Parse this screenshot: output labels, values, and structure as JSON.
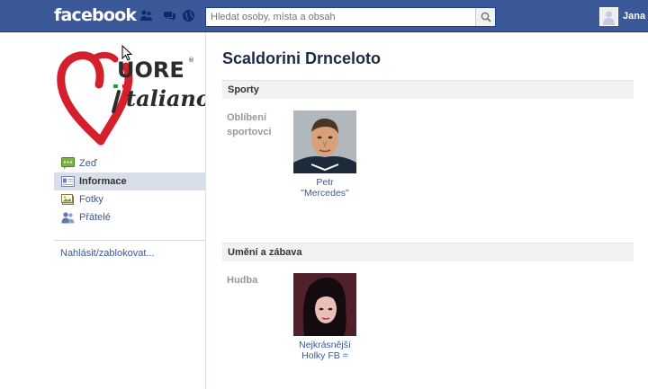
{
  "header": {
    "logo": "facebook",
    "search_placeholder": "Hledat osoby, místa a obsah",
    "user_name": "Jana"
  },
  "sidebar": {
    "items": [
      {
        "label": "Zeď",
        "active": false
      },
      {
        "label": "Informace",
        "active": true
      },
      {
        "label": "Fotky",
        "active": false
      },
      {
        "label": "Přátelé",
        "active": false
      }
    ],
    "report_link": "Nahlásit/zablokovat..."
  },
  "profile": {
    "name": "Scaldorini Drnceloto",
    "logo_text_top": "UORE",
    "logo_text_bottom": "taliano",
    "logo_mark": "®"
  },
  "sections": [
    {
      "title": "Sporty",
      "field": "Oblíbení sportovci",
      "field_lines": [
        "Oblíbení",
        "sportovci"
      ],
      "items": [
        {
          "caption_lines": [
            "Petr",
            "\"Mercedes\""
          ]
        }
      ]
    },
    {
      "title": "Umění a zábava",
      "field": "Hudba",
      "field_lines": [
        "Hudba"
      ],
      "items": [
        {
          "caption_lines": [
            "Nejkrásnější",
            "Holky FB ="
          ]
        }
      ]
    }
  ],
  "colors": {
    "brand": "#3b5998",
    "active_nav": "#d8dfea",
    "logo_red": "#d4202c"
  }
}
